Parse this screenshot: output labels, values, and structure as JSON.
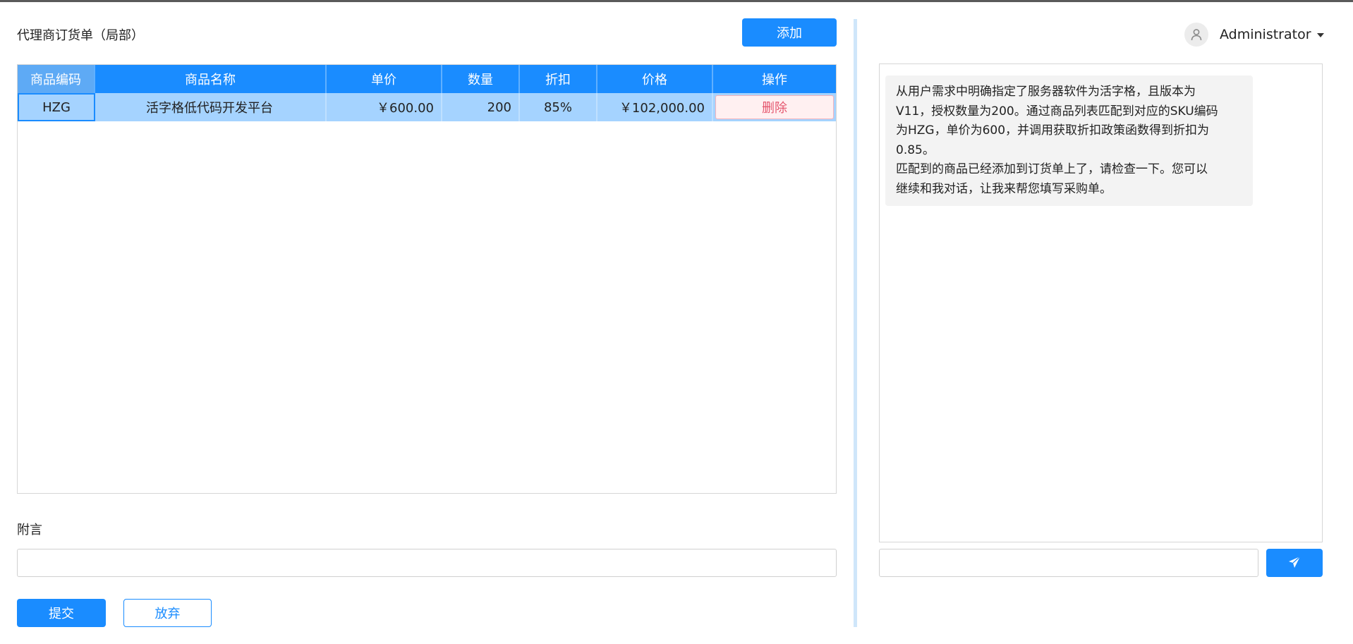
{
  "header": {
    "page_title": "代理商订货单（局部）",
    "add_label": "添加"
  },
  "grid": {
    "columns": [
      "商品编码",
      "商品名称",
      "单价",
      "数量",
      "折扣",
      "价格",
      "操作"
    ],
    "rows": [
      {
        "code": "HZG",
        "name": "活字格低代码开发平台",
        "unit_price": "￥600.00",
        "quantity": "200",
        "discount": "85%",
        "price": "￥102,000.00",
        "action_label": "删除"
      }
    ]
  },
  "note": {
    "label": "附言",
    "value": "",
    "placeholder": ""
  },
  "actions": {
    "submit_label": "提交",
    "abandon_label": "放弃"
  },
  "user": {
    "name": "Administrator"
  },
  "chat": {
    "messages": [
      {
        "lines": [
          "从用户需求中明确指定了服务器软件为活字格，且版本为",
          "V11，授权数量为200。通过商品列表匹配到对应的SKU编码",
          "为HZG，单价为600，并调用获取折扣政策函数得到折扣为",
          "0.85。",
          "匹配到的商品已经添加到订货单上了，请检查一下。您可以",
          "继续和我对话，让我来帮您填写采购单。"
        ]
      }
    ],
    "input_value": "",
    "input_placeholder": ""
  },
  "colors": {
    "primary": "#1a8cff",
    "selected_row": "#a5d3ff",
    "danger_text": "#e5566e",
    "divider": "#cfe6fa"
  },
  "icons": {
    "avatar": "user-icon",
    "send": "paper-plane-icon",
    "dropdown": "caret-down-icon"
  }
}
